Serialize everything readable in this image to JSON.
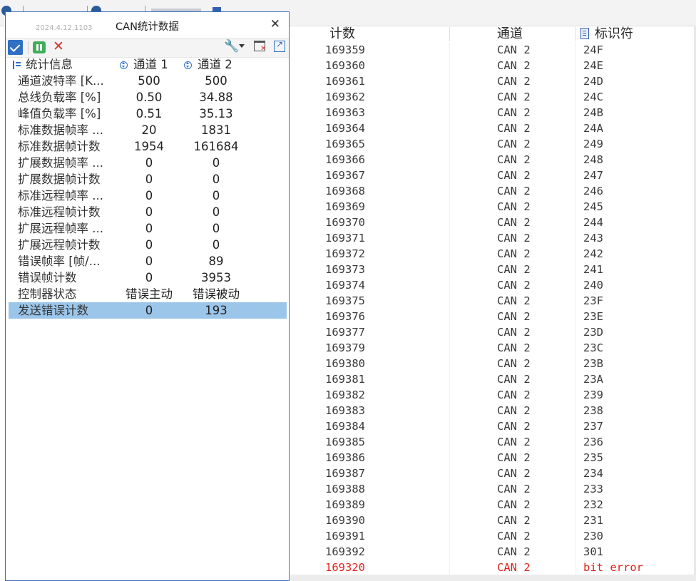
{
  "stat_window": {
    "version": "2024.4.12.1103",
    "title": "CAN统计数据",
    "close_glyph": "✕",
    "toolbar": {
      "wrench_glyph": "🔧",
      "delete_glyph": "✕"
    },
    "headers": {
      "label": "统计信息",
      "ch1": "通道 1",
      "ch2": "通道 2"
    },
    "rows": [
      {
        "label": "通道波特率 [K...",
        "ch1": "500",
        "ch2": "500"
      },
      {
        "label": "总线负载率 [%]",
        "ch1": "0.50",
        "ch2": "34.88"
      },
      {
        "label": "峰值负载率 [%]",
        "ch1": "0.51",
        "ch2": "35.13"
      },
      {
        "label": "标准数据帧率 ...",
        "ch1": "20",
        "ch2": "1831"
      },
      {
        "label": "标准数据帧计数",
        "ch1": "1954",
        "ch2": "161684"
      },
      {
        "label": "扩展数据帧率 ...",
        "ch1": "0",
        "ch2": "0"
      },
      {
        "label": "扩展数据帧计数",
        "ch1": "0",
        "ch2": "0"
      },
      {
        "label": "标准远程帧率 ...",
        "ch1": "0",
        "ch2": "0"
      },
      {
        "label": "标准远程帧计数",
        "ch1": "0",
        "ch2": "0"
      },
      {
        "label": "扩展远程帧率 ...",
        "ch1": "0",
        "ch2": "0"
      },
      {
        "label": "扩展远程帧计数",
        "ch1": "0",
        "ch2": "0"
      },
      {
        "label": "错误帧率 [帧/...",
        "ch1": "0",
        "ch2": "89"
      },
      {
        "label": "错误帧计数",
        "ch1": "0",
        "ch2": "3953"
      },
      {
        "label": "控制器状态",
        "ch1": "错误主动",
        "ch2": "错误被动"
      },
      {
        "label": "发送错误计数",
        "ch1": "0",
        "ch2": "193"
      }
    ],
    "selected_row_index": 14,
    "selected_color": "#9bc6ea"
  },
  "trace": {
    "headers": {
      "count": "计数",
      "channel": "通道",
      "id": "标识符"
    },
    "rows": [
      {
        "count": "169359",
        "channel": "CAN 2",
        "id": "24F"
      },
      {
        "count": "169360",
        "channel": "CAN 2",
        "id": "24E"
      },
      {
        "count": "169361",
        "channel": "CAN 2",
        "id": "24D"
      },
      {
        "count": "169362",
        "channel": "CAN 2",
        "id": "24C"
      },
      {
        "count": "169363",
        "channel": "CAN 2",
        "id": "24B"
      },
      {
        "count": "169364",
        "channel": "CAN 2",
        "id": "24A"
      },
      {
        "count": "169365",
        "channel": "CAN 2",
        "id": "249"
      },
      {
        "count": "169366",
        "channel": "CAN 2",
        "id": "248"
      },
      {
        "count": "169367",
        "channel": "CAN 2",
        "id": "247"
      },
      {
        "count": "169368",
        "channel": "CAN 2",
        "id": "246"
      },
      {
        "count": "169369",
        "channel": "CAN 2",
        "id": "245"
      },
      {
        "count": "169370",
        "channel": "CAN 2",
        "id": "244"
      },
      {
        "count": "169371",
        "channel": "CAN 2",
        "id": "243"
      },
      {
        "count": "169372",
        "channel": "CAN 2",
        "id": "242"
      },
      {
        "count": "169373",
        "channel": "CAN 2",
        "id": "241"
      },
      {
        "count": "169374",
        "channel": "CAN 2",
        "id": "240"
      },
      {
        "count": "169375",
        "channel": "CAN 2",
        "id": "23F"
      },
      {
        "count": "169376",
        "channel": "CAN 2",
        "id": "23E"
      },
      {
        "count": "169377",
        "channel": "CAN 2",
        "id": "23D"
      },
      {
        "count": "169379",
        "channel": "CAN 2",
        "id": "23C"
      },
      {
        "count": "169380",
        "channel": "CAN 2",
        "id": "23B"
      },
      {
        "count": "169381",
        "channel": "CAN 2",
        "id": "23A"
      },
      {
        "count": "169382",
        "channel": "CAN 2",
        "id": "239"
      },
      {
        "count": "169383",
        "channel": "CAN 2",
        "id": "238"
      },
      {
        "count": "169384",
        "channel": "CAN 2",
        "id": "237"
      },
      {
        "count": "169385",
        "channel": "CAN 2",
        "id": "236"
      },
      {
        "count": "169386",
        "channel": "CAN 2",
        "id": "235"
      },
      {
        "count": "169387",
        "channel": "CAN 2",
        "id": "234"
      },
      {
        "count": "169388",
        "channel": "CAN 2",
        "id": "233"
      },
      {
        "count": "169389",
        "channel": "CAN 2",
        "id": "232"
      },
      {
        "count": "169390",
        "channel": "CAN 2",
        "id": "231"
      },
      {
        "count": "169391",
        "channel": "CAN 2",
        "id": "230"
      },
      {
        "count": "169392",
        "channel": "CAN 2",
        "id": "301"
      },
      {
        "count": "169320",
        "channel": "CAN 2",
        "id": "bit error",
        "error": true
      }
    ],
    "error_color": "#e0231d"
  }
}
